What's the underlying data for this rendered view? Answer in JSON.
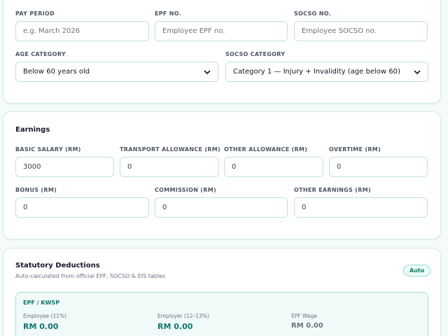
{
  "employee_details": {
    "pay_period": {
      "label": "PAY PERIOD",
      "value": "",
      "placeholder": "e.g. March 2026"
    },
    "epf_no": {
      "label": "EPF NO.",
      "value": "",
      "placeholder": "Employee EPF no."
    },
    "socso_no": {
      "label": "SOCSO NO.",
      "value": "",
      "placeholder": "Employee SOCSO no."
    },
    "age_category": {
      "label": "AGE CATEGORY",
      "selected": "Below 60 years old"
    },
    "socso_category": {
      "label": "SOCSO CATEGORY",
      "selected": "Category 1 — Injury + Invalidity (age below 60)"
    }
  },
  "earnings": {
    "title": "Earnings",
    "fields": [
      {
        "label": "BASIC SALARY (RM)",
        "value": "3000"
      },
      {
        "label": "TRANSPORT ALLOWANCE (RM)",
        "value": "0"
      },
      {
        "label": "OTHER ALLOWANCE (RM)",
        "value": "0"
      },
      {
        "label": "OVERTIME (RM)",
        "value": "0"
      },
      {
        "label": "BONUS (RM)",
        "value": "0"
      },
      {
        "label": "COMMISSION (RM)",
        "value": "0"
      },
      {
        "label": "OTHER EARNINGS (RM)",
        "value": "0"
      }
    ]
  },
  "statutory": {
    "title": "Statutory Deductions",
    "subtitle": "Auto-calculated from official EPF, SOCSO & EIS tables",
    "badge": "Auto",
    "epf": {
      "title": "EPF / KWSP",
      "employee_label": "Employee (11%)",
      "employee_value": "RM 0.00",
      "employer_label": "Employer (12–13%)",
      "employer_value": "RM 0.00",
      "wage_label": "EPF Wage",
      "wage_value": "RM 0.00"
    }
  },
  "colors": {
    "accent": "#0f766e",
    "border": "#bfe3dc",
    "background": "#f5fbfa"
  },
  "icons": {
    "select_chevron": "chevron-down-icon"
  }
}
